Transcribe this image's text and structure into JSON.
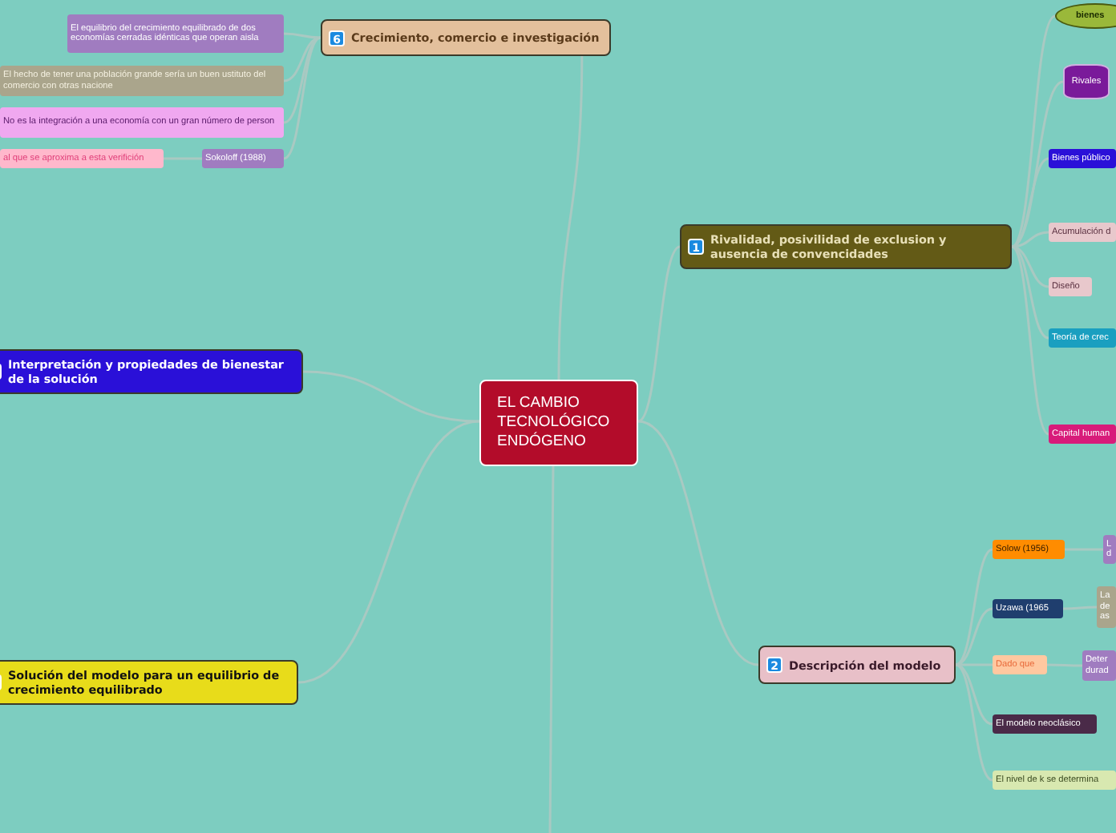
{
  "map": {
    "center": {
      "title": "EL CAMBIO TECNOLÓGICO ENDÓGENO",
      "color": "#b30c2a"
    },
    "topics": [
      {
        "number": "6",
        "title": "Crecimiento, comercio e investigación",
        "color": "#e3c09c",
        "children": [
          {
            "kind": "box",
            "text": "El equilibrio del crecimiento equilibrado de dos economías cerradas idénticas que operan aisla",
            "color": "#a07cc0"
          },
          {
            "kind": "box",
            "text": "El hecho de tener una población grande sería un buen ustituto del comercio con otras nacione",
            "color": "#aaa58c"
          },
          {
            "kind": "box",
            "text": "No es la integración a una economía con un gran número de person",
            "color": "#f0a8f0"
          },
          {
            "kind": "box",
            "text": "Sokoloff (1988)",
            "color": "#a07cc0",
            "children": [
              {
                "kind": "box",
                "text": "al que se aproxima a esta verifición",
                "color": "#ffb8cc"
              }
            ]
          }
        ]
      },
      {
        "number": "1",
        "title": "Rivalidad, posivilidad de exclusion y ausencia de convencidades",
        "color": "#635a16",
        "children": [
          {
            "kind": "ellipse",
            "text": "bienes",
            "color": "#9ab83a"
          },
          {
            "kind": "cylinder",
            "text": "Rivales",
            "color": "#7a1a9a"
          },
          {
            "kind": "box",
            "text": "Bienes público",
            "color": "#2a10d8"
          },
          {
            "kind": "box",
            "text": "Acumulación d",
            "color": "#e8c8cc"
          },
          {
            "kind": "box",
            "text": "Diseño",
            "color": "#e8c8cc"
          },
          {
            "kind": "box",
            "text": "Teoría de crec",
            "color": "#1a9fc0"
          },
          {
            "kind": "box",
            "text": "Capital human",
            "color": "#d81b7a"
          }
        ]
      },
      {
        "title": "Interpretación y propiedades de bienestar de la solución",
        "color": "#2a10d8"
      },
      {
        "title": "Solución del modelo para un equilibrio de crecimiento equilibrado",
        "color": "#e8dc1a"
      },
      {
        "number": "2",
        "title": "Descripción del modelo",
        "color": "#e8c0c8",
        "children": [
          {
            "kind": "box",
            "text": "Solow (1956)",
            "color": "#ff8c00",
            "children": [
              {
                "kind": "box",
                "text": "L d",
                "color": "#a07cc0"
              }
            ]
          },
          {
            "kind": "box",
            "text": "Uzawa (1965",
            "color": "#1f3e6e",
            "children": [
              {
                "kind": "box",
                "text": "La de as",
                "color": "#aaa58c"
              }
            ]
          },
          {
            "kind": "box",
            "text": "Dado que",
            "color": "#ffc8a0",
            "children": [
              {
                "kind": "box",
                "text": "Deter durad",
                "color": "#a07cc0"
              }
            ]
          },
          {
            "kind": "box",
            "text": "El modelo neoclásico",
            "color": "#4a2a48"
          },
          {
            "kind": "box",
            "text": "El nivel de k se determina",
            "color": "#d8e8b0"
          }
        ]
      }
    ]
  }
}
